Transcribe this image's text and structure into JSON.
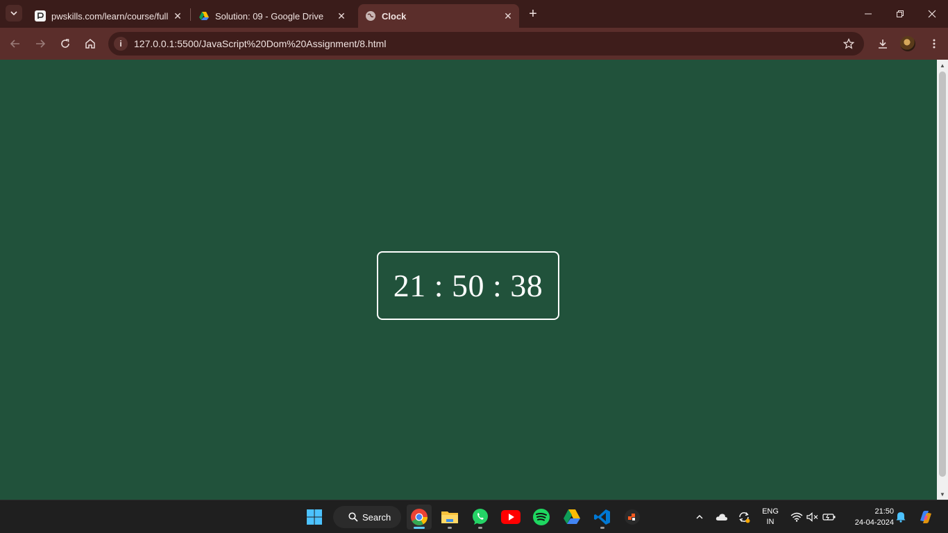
{
  "browser": {
    "tabs": [
      {
        "title": "pwskills.com/learn/course/full",
        "favicon": "pwskills-favicon",
        "active": false
      },
      {
        "title": "Solution: 09 - Google Drive",
        "favicon": "google-drive-favicon",
        "active": false
      },
      {
        "title": "Clock",
        "favicon": "globe-favicon",
        "active": true
      }
    ],
    "url": "127.0.0.1:5500/JavaScript%20Dom%20Assignment/8.html"
  },
  "page": {
    "clock_text": "21 : 50 : 38",
    "background_color": "#21523b",
    "text_color": "#ffffff"
  },
  "taskbar": {
    "search_label": "Search",
    "apps": [
      "windows-start-icon",
      "chrome-icon",
      "file-explorer-icon",
      "whatsapp-icon",
      "youtube-icon",
      "spotify-icon",
      "google-drive-icon",
      "vscode-icon",
      "app-icon"
    ],
    "language": {
      "line1": "ENG",
      "line2": "IN"
    },
    "time": "21:50",
    "date": "24-04-2024"
  },
  "colors": {
    "titlebar": "#3a1c1a",
    "toolbar": "#5b2e2b",
    "omnibox": "#3e1d1b",
    "taskbar": "#1f1f1f"
  }
}
